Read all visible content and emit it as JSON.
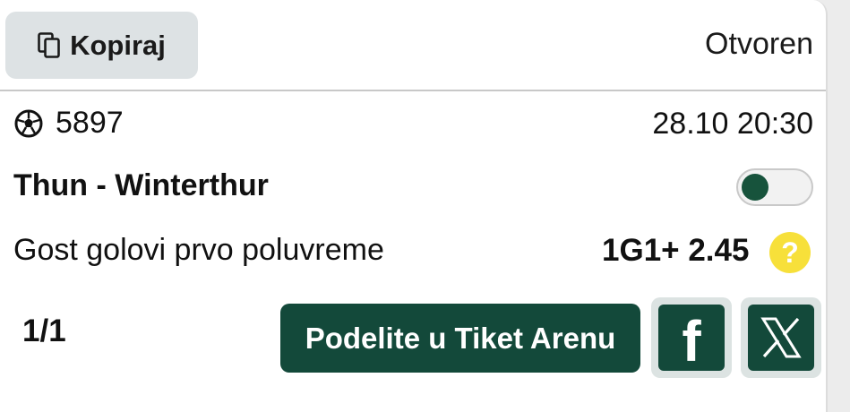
{
  "header": {
    "copy_label": "Kopiraj",
    "copy_icon": "copy-icon",
    "status": "Otvoren"
  },
  "event": {
    "sport_icon": "soccer-ball-icon",
    "code": "5897",
    "datetime": "28.10 20:30",
    "match": "Thun - Winterthur",
    "market": "Gost golovi prvo poluvreme",
    "pick": "1G1+ 2.45",
    "help_icon": "question-icon",
    "help_glyph": "?"
  },
  "footer": {
    "pages": "1/1",
    "share_label": "Podelite u Tiket Arenu",
    "facebook_icon": "facebook-icon",
    "facebook_glyph": "f",
    "x_icon": "x-icon"
  },
  "colors": {
    "brand_dark_green": "#13493a",
    "copy_button_bg": "#dde2e4",
    "help_yellow": "#f7e03a"
  }
}
